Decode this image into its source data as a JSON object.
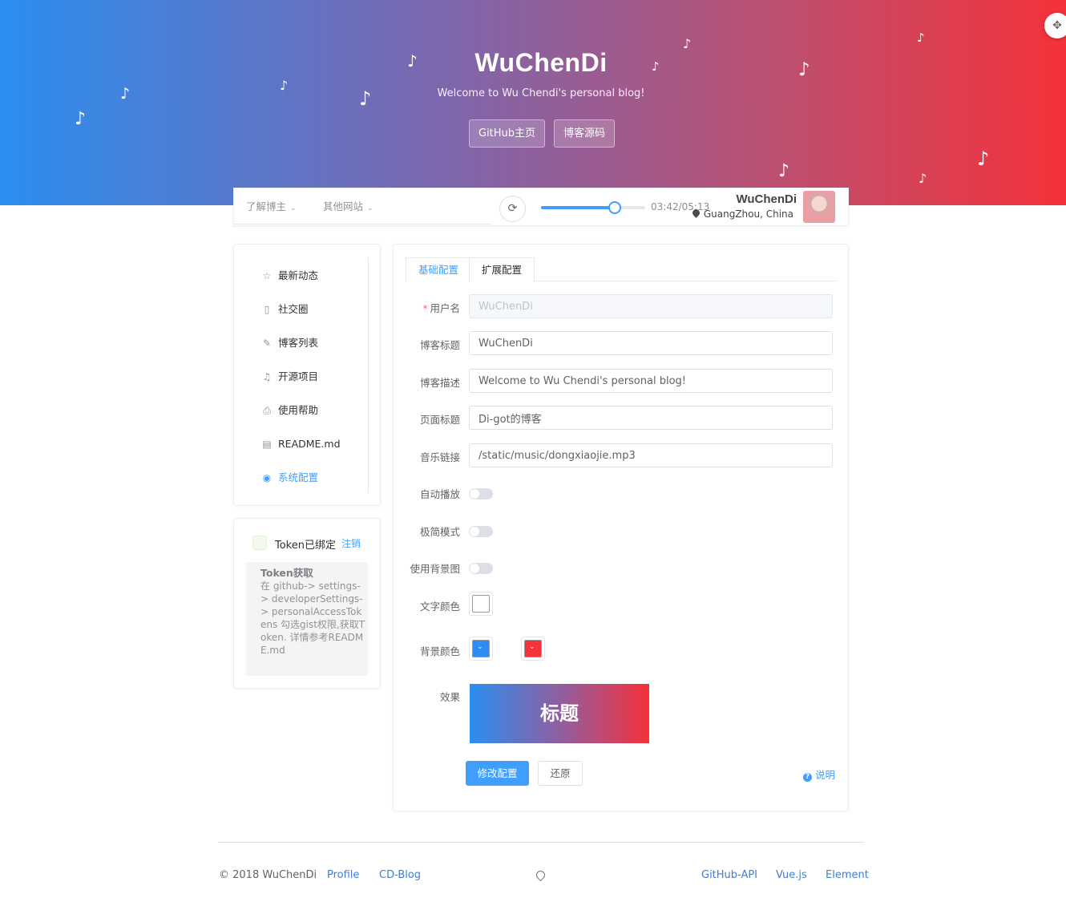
{
  "banner": {
    "title": "WuChenDi",
    "subtitle": "Welcome to Wu Chendi's personal blog!",
    "buttons": [
      "GitHub主页",
      "博客源码"
    ],
    "note_glyph": "♪",
    "expand_icon": "✥"
  },
  "navbar": {
    "menu": [
      "了解博主",
      "其他网站"
    ],
    "chevron": "⌄",
    "sync_glyph": "⟳",
    "player": {
      "progress": 0.71,
      "time": "03:42/05:13"
    },
    "user": {
      "name": "WuChenDi",
      "location": "GuangZhou, China"
    }
  },
  "sidebar": {
    "items": [
      {
        "label": "最新动态",
        "icon": "☆"
      },
      {
        "label": "社交圈",
        "icon": "▯"
      },
      {
        "label": "博客列表",
        "icon": "✎"
      },
      {
        "label": "开源项目",
        "icon": "♫"
      },
      {
        "label": "使用帮助",
        "icon": "⎙"
      },
      {
        "label": "README.md",
        "icon": "▤"
      },
      {
        "label": "系统配置",
        "icon": "◉"
      }
    ],
    "active_index": 6
  },
  "token": {
    "label": "Token已绑定",
    "logout": "注销",
    "help_title": "Token获取",
    "help_body": "在 github-> settings-> developerSettings-> personalAccessTokens 勾选gist权限,获取Token. 详情参考README.md"
  },
  "config": {
    "tabs": [
      "基础配置",
      "扩展配置"
    ],
    "active_tab": 0,
    "fields": {
      "username": {
        "label": "用户名",
        "value": "WuChenDi"
      },
      "blog_title": {
        "label": "博客标题",
        "value": "WuChenDi"
      },
      "blog_desc": {
        "label": "博客描述",
        "value": "Welcome to Wu Chendi's personal blog!"
      },
      "page_title": {
        "label": "页面标题",
        "value": "Di-got的博客"
      },
      "music_url": {
        "label": "音乐链接",
        "value": "/static/music/dongxiaojie.mp3"
      }
    },
    "switches": {
      "autoplay": {
        "label": "自动播放",
        "on": false
      },
      "minimal": {
        "label": "极简模式",
        "on": false
      },
      "bg_image": {
        "label": "使用背景图",
        "on": false
      }
    },
    "text_color": {
      "label": "文字颜色",
      "value": "#ffffff"
    },
    "bg_color": {
      "label": "背景颜色",
      "start": "#2b8ef0",
      "end": "#f5313a",
      "arrow": "⌄"
    },
    "preview": {
      "label": "效果",
      "text": "标题"
    },
    "submit": "修改配置",
    "reset": "还原",
    "help": "说明",
    "help_icon": "?",
    "required_mark": "*"
  },
  "footer": {
    "copyright": "© 2018 WuChenDi",
    "left_links": [
      "Profile",
      "CD-Blog"
    ],
    "right_links": [
      "GitHub-API",
      "Vue.js",
      "Element"
    ]
  },
  "colors": {
    "accent": "#409eff",
    "banner_start": "#2b8ef0",
    "banner_end": "#f5313a"
  }
}
